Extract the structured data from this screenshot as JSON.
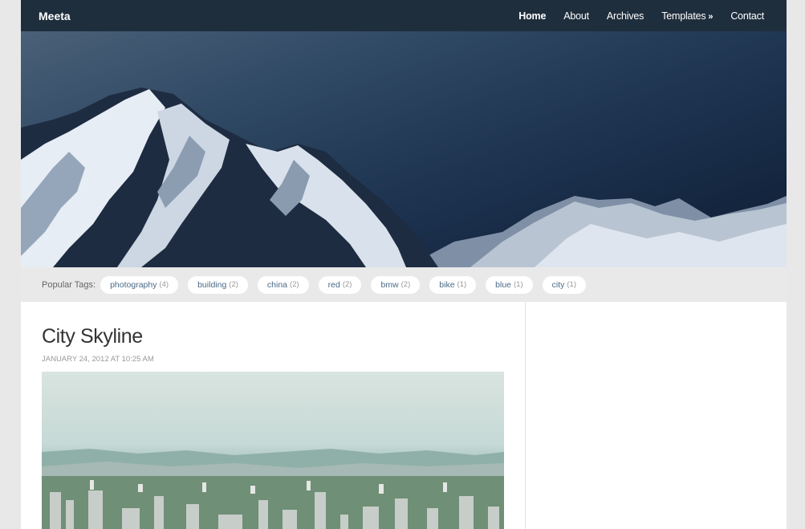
{
  "site": {
    "brand": "Meeta"
  },
  "nav": [
    {
      "label": "Home",
      "active": true
    },
    {
      "label": "About",
      "active": false
    },
    {
      "label": "Archives",
      "active": false
    },
    {
      "label": "Templates",
      "active": false,
      "suffix": "»"
    },
    {
      "label": "Contact",
      "active": false
    }
  ],
  "tags": {
    "label": "Popular Tags:",
    "items": [
      {
        "name": "photography",
        "count": "(4)"
      },
      {
        "name": "building",
        "count": "(2)"
      },
      {
        "name": "china",
        "count": "(2)"
      },
      {
        "name": "red",
        "count": "(2)"
      },
      {
        "name": "bmw",
        "count": "(2)"
      },
      {
        "name": "bike",
        "count": "(1)"
      },
      {
        "name": "blue",
        "count": "(1)"
      },
      {
        "name": "city",
        "count": "(1)"
      }
    ]
  },
  "post": {
    "title": "City Skyline",
    "date": "JANUARY 24, 2012 AT 10:25 AM"
  },
  "colors": {
    "topbar": "#1f2e3d",
    "tag_text": "#4a6a86",
    "tagbar_bg": "#e9e9e9"
  }
}
